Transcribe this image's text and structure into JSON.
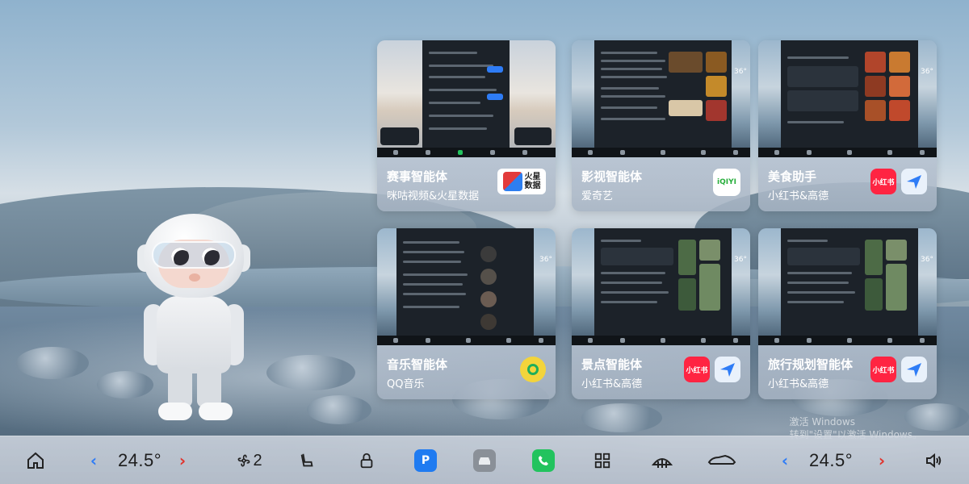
{
  "agents": [
    {
      "title": "赛事智能体",
      "subtitle": "咪咕视频&火星数据",
      "logos": [
        "migu-logo",
        "huoxing-data-logo"
      ],
      "logo_text": "火星\n数据"
    },
    {
      "title": "影视智能体",
      "subtitle": "爱奇艺",
      "logos": [
        "iqiyi-logo"
      ],
      "logo_text": "iQIYI"
    },
    {
      "title": "美食助手",
      "subtitle": "小红书&高德",
      "logos": [
        "xiaohongshu-logo",
        "gaode-map-logo"
      ],
      "logo_text": "小红书"
    },
    {
      "title": "音乐智能体",
      "subtitle": "QQ音乐",
      "logos": [
        "qq-music-logo"
      ]
    },
    {
      "title": "景点智能体",
      "subtitle": "小红书&高德",
      "logos": [
        "xiaohongshu-logo",
        "gaode-map-logo"
      ],
      "logo_text": "小红书"
    },
    {
      "title": "旅行规划智能体",
      "subtitle": "小红书&高德",
      "logos": [
        "xiaohongshu-logo",
        "gaode-map-logo"
      ],
      "logo_text": "小红书"
    }
  ],
  "dock": {
    "left_temp": "24.5°",
    "right_temp": "24.5°",
    "fan_level": "2",
    "icons": [
      "home-icon",
      "fan-icon",
      "seat-icon",
      "lock-icon",
      "parking-app-icon",
      "car-app-icon",
      "phone-app-icon",
      "apps-grid-icon",
      "defrost-icon",
      "car-body-icon",
      "volume-icon"
    ]
  },
  "watermark": {
    "line1": "激活 Windows",
    "line2": "转到\"设置\"以激活 Windows。"
  },
  "colors": {
    "accent_blue": "#2e7cf6",
    "accent_red": "#e0342e",
    "xiaohongshu": "#ff2442",
    "phone_green": "#22c35e"
  }
}
